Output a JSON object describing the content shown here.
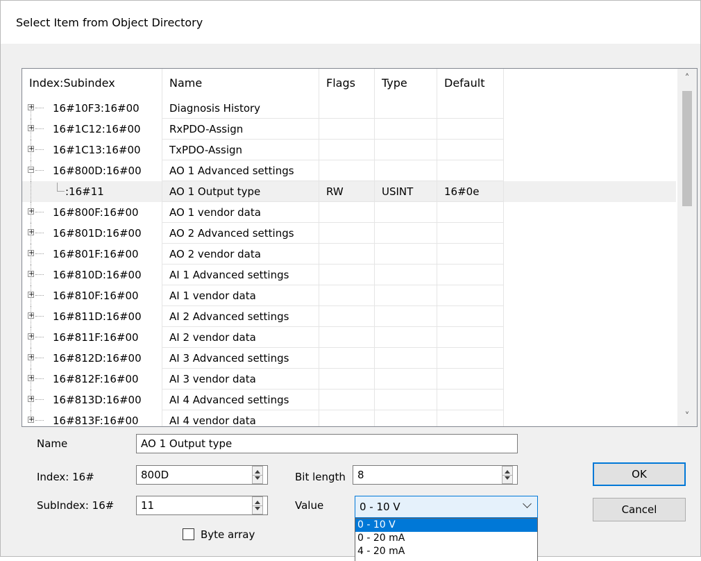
{
  "dialog": {
    "title": "Select Item from Object Directory"
  },
  "tree": {
    "columns": [
      "Index:Subindex",
      "Name",
      "Flags",
      "Type",
      "Default"
    ],
    "rows": [
      {
        "expander": "+",
        "index": "16#10F3:16#00",
        "name": "Diagnosis History",
        "flags": "",
        "type": "",
        "default": ""
      },
      {
        "expander": "+",
        "index": "16#1C12:16#00",
        "name": "RxPDO-Assign",
        "flags": "",
        "type": "",
        "default": ""
      },
      {
        "expander": "+",
        "index": "16#1C13:16#00",
        "name": "TxPDO-Assign",
        "flags": "",
        "type": "",
        "default": ""
      },
      {
        "expander": "−",
        "index": "16#800D:16#00",
        "name": "AO 1 Advanced settings",
        "flags": "",
        "type": "",
        "default": ""
      },
      {
        "expander": "",
        "index": ":16#11",
        "name": "AO 1 Output type",
        "flags": "RW",
        "type": "USINT",
        "default": "16#0e",
        "selected": true,
        "child": true
      },
      {
        "expander": "+",
        "index": "16#800F:16#00",
        "name": "AO 1 vendor data",
        "flags": "",
        "type": "",
        "default": ""
      },
      {
        "expander": "+",
        "index": "16#801D:16#00",
        "name": "AO 2 Advanced settings",
        "flags": "",
        "type": "",
        "default": ""
      },
      {
        "expander": "+",
        "index": "16#801F:16#00",
        "name": "AO 2 vendor data",
        "flags": "",
        "type": "",
        "default": ""
      },
      {
        "expander": "+",
        "index": "16#810D:16#00",
        "name": "AI 1 Advanced settings",
        "flags": "",
        "type": "",
        "default": ""
      },
      {
        "expander": "+",
        "index": "16#810F:16#00",
        "name": "AI 1 vendor data",
        "flags": "",
        "type": "",
        "default": ""
      },
      {
        "expander": "+",
        "index": "16#811D:16#00",
        "name": "AI 2 Advanced settings",
        "flags": "",
        "type": "",
        "default": ""
      },
      {
        "expander": "+",
        "index": "16#811F:16#00",
        "name": "AI 2 vendor data",
        "flags": "",
        "type": "",
        "default": ""
      },
      {
        "expander": "+",
        "index": "16#812D:16#00",
        "name": "AI 3 Advanced settings",
        "flags": "",
        "type": "",
        "default": ""
      },
      {
        "expander": "+",
        "index": "16#812F:16#00",
        "name": "AI 3 vendor data",
        "flags": "",
        "type": "",
        "default": ""
      },
      {
        "expander": "+",
        "index": "16#813D:16#00",
        "name": "AI 4 Advanced settings",
        "flags": "",
        "type": "",
        "default": ""
      },
      {
        "expander": "+",
        "index": "16#813F:16#00",
        "name": "AI 4 vendor data",
        "flags": "",
        "type": "",
        "default": ""
      }
    ]
  },
  "form": {
    "name_label": "Name",
    "name_value": "AO 1 Output type",
    "index_label": "Index: 16#",
    "index_value": "800D",
    "subindex_label": "SubIndex: 16#",
    "subindex_value": "11",
    "bitlength_label": "Bit length",
    "bitlength_value": "8",
    "value_label": "Value",
    "value_selected": "0 - 10 V",
    "value_options": [
      "0 - 10 V",
      "0 - 20 mA",
      "4 - 20 mA"
    ],
    "bytearray_label": "Byte array",
    "bytearray_checked": false
  },
  "buttons": {
    "ok": "OK",
    "cancel": "Cancel"
  },
  "icons": {
    "scroll_up": "chevron-up-icon",
    "scroll_down": "chevron-down-icon",
    "combo_arrow": "chevron-down-icon",
    "expand": "plus-box-icon",
    "collapse": "minus-box-icon"
  },
  "colors": {
    "accent": "#0078d7",
    "dialog_bg": "#f0f0f0",
    "combo_bg": "#e5f1fb",
    "selection_row": "#f0f0f0"
  }
}
